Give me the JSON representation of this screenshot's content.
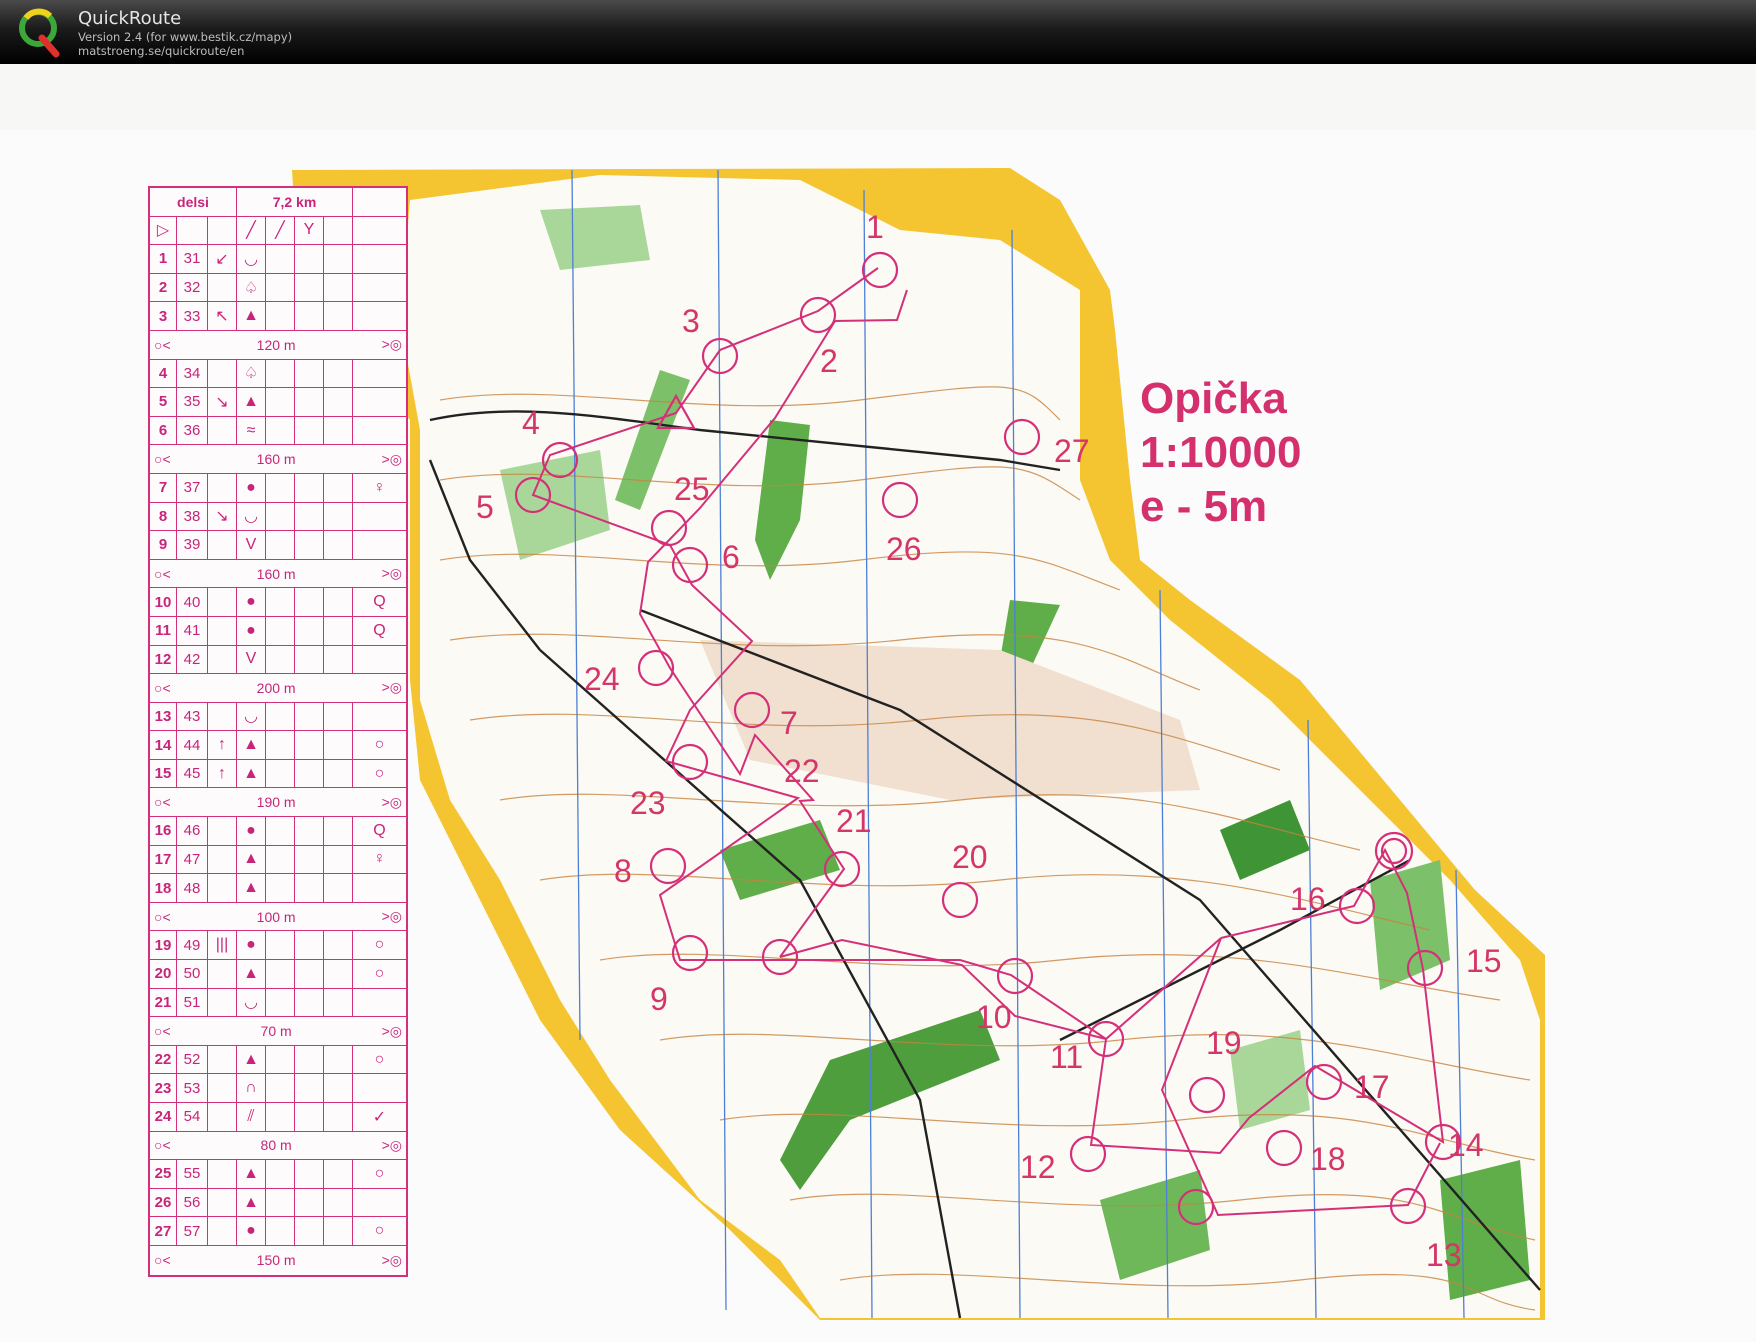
{
  "app": {
    "name": "QuickRoute",
    "version_line": "Version 2.4  (for www.bestik.cz/mapy)",
    "url_line": "matstroeng.se/quickroute/en"
  },
  "map": {
    "title": "Opička",
    "scale": "1:10000",
    "contour": "e - 5m"
  },
  "description_sheet": {
    "course": "delsi",
    "length": "7,2 km",
    "rows": [
      {
        "type": "control",
        "num": "1",
        "code": "31",
        "c3": "↙",
        "c4": "◡",
        "c8": ""
      },
      {
        "type": "control",
        "num": "2",
        "code": "32",
        "c3": "",
        "c4": "♤",
        "c8": ""
      },
      {
        "type": "control",
        "num": "3",
        "code": "33",
        "c3": "↖",
        "c4": "▲",
        "c8": ""
      },
      {
        "type": "sep",
        "dist": "120 m"
      },
      {
        "type": "control",
        "num": "4",
        "code": "34",
        "c3": "",
        "c4": "♤",
        "c8": ""
      },
      {
        "type": "control",
        "num": "5",
        "code": "35",
        "c3": "↘",
        "c4": "▲",
        "c8": ""
      },
      {
        "type": "control",
        "num": "6",
        "code": "36",
        "c3": "",
        "c4": "≈",
        "c8": ""
      },
      {
        "type": "sep",
        "dist": "160 m"
      },
      {
        "type": "control",
        "num": "7",
        "code": "37",
        "c3": "",
        "c4": "●",
        "c8": "♀"
      },
      {
        "type": "control",
        "num": "8",
        "code": "38",
        "c3": "↘",
        "c4": "◡",
        "c8": ""
      },
      {
        "type": "control",
        "num": "9",
        "code": "39",
        "c3": "",
        "c4": "V",
        "c8": ""
      },
      {
        "type": "sep",
        "dist": "160 m"
      },
      {
        "type": "control",
        "num": "10",
        "code": "40",
        "c3": "",
        "c4": "●",
        "c8": "Q"
      },
      {
        "type": "control",
        "num": "11",
        "code": "41",
        "c3": "",
        "c4": "●",
        "c8": "Q"
      },
      {
        "type": "control",
        "num": "12",
        "code": "42",
        "c3": "",
        "c4": "V",
        "c8": ""
      },
      {
        "type": "sep",
        "dist": "200 m"
      },
      {
        "type": "control",
        "num": "13",
        "code": "43",
        "c3": "",
        "c4": "◡",
        "c8": ""
      },
      {
        "type": "control",
        "num": "14",
        "code": "44",
        "c3": "↑",
        "c4": "▲",
        "c8": "○"
      },
      {
        "type": "control",
        "num": "15",
        "code": "45",
        "c3": "↑",
        "c4": "▲",
        "c8": "○"
      },
      {
        "type": "sep",
        "dist": "190 m"
      },
      {
        "type": "control",
        "num": "16",
        "code": "46",
        "c3": "",
        "c4": "●",
        "c8": "Q"
      },
      {
        "type": "control",
        "num": "17",
        "code": "47",
        "c3": "",
        "c4": "▲",
        "c8": "♀"
      },
      {
        "type": "control",
        "num": "18",
        "code": "48",
        "c3": "",
        "c4": "▲",
        "c8": ""
      },
      {
        "type": "sep",
        "dist": "100 m"
      },
      {
        "type": "control",
        "num": "19",
        "code": "49",
        "c3": "|||",
        "c4": "●",
        "c8": "○"
      },
      {
        "type": "control",
        "num": "20",
        "code": "50",
        "c3": "",
        "c4": "▲",
        "c8": "○"
      },
      {
        "type": "control",
        "num": "21",
        "code": "51",
        "c3": "",
        "c4": "◡",
        "c8": ""
      },
      {
        "type": "sep",
        "dist": "70 m"
      },
      {
        "type": "control",
        "num": "22",
        "code": "52",
        "c3": "",
        "c4": "▲",
        "c8": "○"
      },
      {
        "type": "control",
        "num": "23",
        "code": "53",
        "c3": "",
        "c4": "∩",
        "c8": ""
      },
      {
        "type": "control",
        "num": "24",
        "code": "54",
        "c3": "",
        "c4": "⫽",
        "c8": "✓"
      },
      {
        "type": "sep",
        "dist": "80 m"
      },
      {
        "type": "control",
        "num": "25",
        "code": "55",
        "c3": "",
        "c4": "▲",
        "c8": "○"
      },
      {
        "type": "control",
        "num": "26",
        "code": "56",
        "c3": "",
        "c4": "▲",
        "c8": ""
      },
      {
        "type": "control",
        "num": "27",
        "code": "57",
        "c3": "",
        "c4": "●",
        "c8": "○"
      },
      {
        "type": "sep",
        "dist": "150 m"
      }
    ]
  },
  "controls": [
    "1",
    "2",
    "3",
    "4",
    "5",
    "6",
    "7",
    "8",
    "9",
    "10",
    "11",
    "12",
    "13",
    "14",
    "15",
    "16",
    "17",
    "18",
    "19",
    "20",
    "21",
    "22",
    "23",
    "24",
    "25",
    "26",
    "27"
  ],
  "colors": {
    "overprint": "#d4307a",
    "yellow": "#f4c531",
    "green": "#5fae4a",
    "light_green": "#a9d79a",
    "contour": "#c9833f"
  }
}
